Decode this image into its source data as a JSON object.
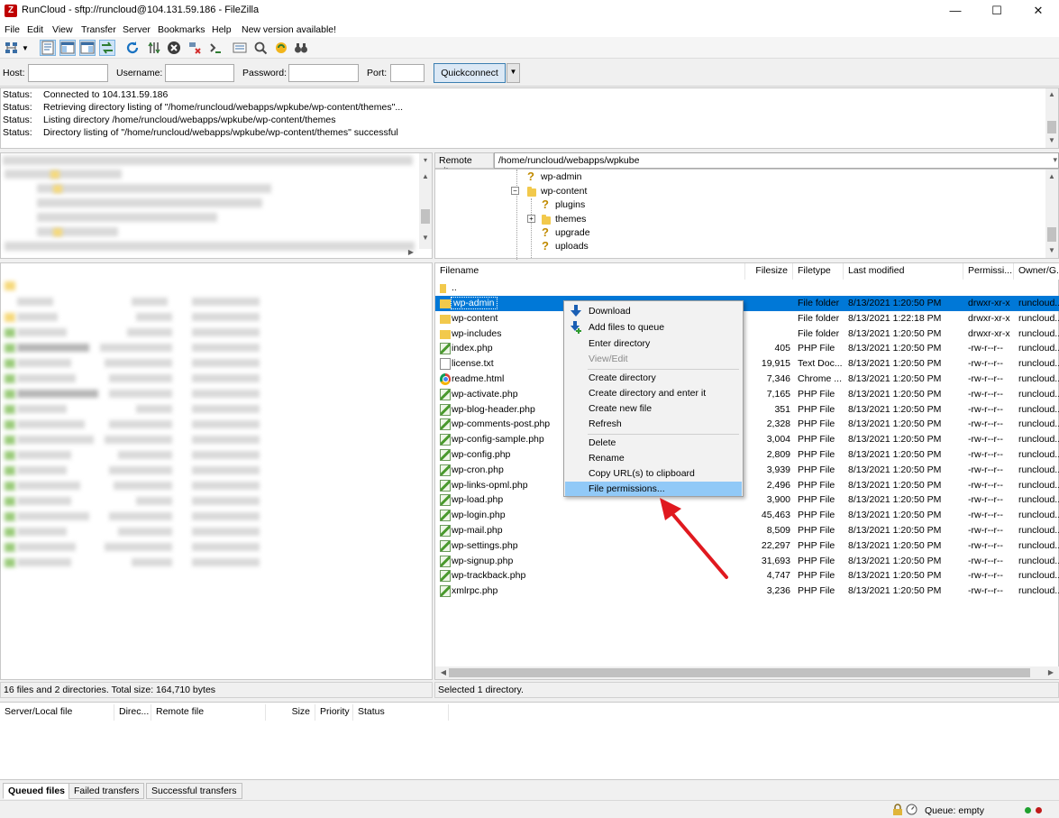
{
  "window": {
    "title": "RunCloud - sftp://runcloud@104.131.59.186 - FileZilla",
    "app_icon": "Z",
    "controls": [
      "—",
      "☐",
      "✕"
    ]
  },
  "menu": [
    "File",
    "Edit",
    "View",
    "Transfer",
    "Server",
    "Bookmarks",
    "Help",
    "New version available!"
  ],
  "quickconnect": {
    "host_label": "Host:",
    "host_value": "",
    "username_label": "Username:",
    "username_value": "",
    "password_label": "Password:",
    "password_value": "",
    "port_label": "Port:",
    "port_value": "",
    "button_label": "Quickconnect",
    "dropdown_icon": "▼"
  },
  "log": [
    {
      "k": "Status:",
      "v": "Connected to 104.131.59.186"
    },
    {
      "k": "Status:",
      "v": "Retrieving directory listing of \"/home/runcloud/webapps/wpkube/wp-content/themes\"..."
    },
    {
      "k": "Status:",
      "v": "Listing directory /home/runcloud/webapps/wpkube/wp-content/themes"
    },
    {
      "k": "Status:",
      "v": "Directory listing of \"/home/runcloud/webapps/wpkube/wp-content/themes\" successful"
    }
  ],
  "remote": {
    "site_label": "Remote site:",
    "site_path": "/home/runcloud/webapps/wpkube",
    "tree": [
      {
        "label": "wp-admin",
        "icon": "?"
      },
      {
        "label": "wp-content",
        "icon": "folder"
      },
      {
        "label": "plugins",
        "icon": "?"
      },
      {
        "label": "themes",
        "icon": "folder"
      },
      {
        "label": "upgrade",
        "icon": "?"
      },
      {
        "label": "uploads",
        "icon": "?"
      }
    ],
    "columns": [
      "Filename",
      "Filesize",
      "Filetype",
      "Last modified",
      "Permissi...",
      "Owner/G..."
    ],
    "parent_dir": "..",
    "files": [
      {
        "name": "wp-admin",
        "size": "",
        "type": "File folder",
        "modified": "8/13/2021 1:20:50 PM",
        "perms": "drwxr-xr-x",
        "owner": "runcloud...",
        "icon": "dir"
      },
      {
        "name": "wp-content",
        "size": "",
        "type": "File folder",
        "modified": "8/13/2021 1:22:18 PM",
        "perms": "drwxr-xr-x",
        "owner": "runcloud...",
        "icon": "dir"
      },
      {
        "name": "wp-includes",
        "size": "",
        "type": "File folder",
        "modified": "8/13/2021 1:20:50 PM",
        "perms": "drwxr-xr-x",
        "owner": "runcloud...",
        "icon": "dir"
      },
      {
        "name": "index.php",
        "size": "405",
        "type": "PHP File",
        "modified": "8/13/2021 1:20:50 PM",
        "perms": "-rw-r--r--",
        "owner": "runcloud...",
        "icon": "php"
      },
      {
        "name": "license.txt",
        "size": "19,915",
        "type": "Text Doc...",
        "modified": "8/13/2021 1:20:50 PM",
        "perms": "-rw-r--r--",
        "owner": "runcloud...",
        "icon": "txt"
      },
      {
        "name": "readme.html",
        "size": "7,346",
        "type": "Chrome ...",
        "modified": "8/13/2021 1:20:50 PM",
        "perms": "-rw-r--r--",
        "owner": "runcloud...",
        "icon": "chrome"
      },
      {
        "name": "wp-activate.php",
        "size": "7,165",
        "type": "PHP File",
        "modified": "8/13/2021 1:20:50 PM",
        "perms": "-rw-r--r--",
        "owner": "runcloud...",
        "icon": "php"
      },
      {
        "name": "wp-blog-header.php",
        "size": "351",
        "type": "PHP File",
        "modified": "8/13/2021 1:20:50 PM",
        "perms": "-rw-r--r--",
        "owner": "runcloud...",
        "icon": "php"
      },
      {
        "name": "wp-comments-post.php",
        "size": "2,328",
        "type": "PHP File",
        "modified": "8/13/2021 1:20:50 PM",
        "perms": "-rw-r--r--",
        "owner": "runcloud...",
        "icon": "php"
      },
      {
        "name": "wp-config-sample.php",
        "size": "3,004",
        "type": "PHP File",
        "modified": "8/13/2021 1:20:50 PM",
        "perms": "-rw-r--r--",
        "owner": "runcloud...",
        "icon": "php"
      },
      {
        "name": "wp-config.php",
        "size": "2,809",
        "type": "PHP File",
        "modified": "8/13/2021 1:20:50 PM",
        "perms": "-rw-r--r--",
        "owner": "runcloud...",
        "icon": "php"
      },
      {
        "name": "wp-cron.php",
        "size": "3,939",
        "type": "PHP File",
        "modified": "8/13/2021 1:20:50 PM",
        "perms": "-rw-r--r--",
        "owner": "runcloud...",
        "icon": "php"
      },
      {
        "name": "wp-links-opml.php",
        "size": "2,496",
        "type": "PHP File",
        "modified": "8/13/2021 1:20:50 PM",
        "perms": "-rw-r--r--",
        "owner": "runcloud...",
        "icon": "php"
      },
      {
        "name": "wp-load.php",
        "size": "3,900",
        "type": "PHP File",
        "modified": "8/13/2021 1:20:50 PM",
        "perms": "-rw-r--r--",
        "owner": "runcloud...",
        "icon": "php"
      },
      {
        "name": "wp-login.php",
        "size": "45,463",
        "type": "PHP File",
        "modified": "8/13/2021 1:20:50 PM",
        "perms": "-rw-r--r--",
        "owner": "runcloud...",
        "icon": "php"
      },
      {
        "name": "wp-mail.php",
        "size": "8,509",
        "type": "PHP File",
        "modified": "8/13/2021 1:20:50 PM",
        "perms": "-rw-r--r--",
        "owner": "runcloud...",
        "icon": "php"
      },
      {
        "name": "wp-settings.php",
        "size": "22,297",
        "type": "PHP File",
        "modified": "8/13/2021 1:20:50 PM",
        "perms": "-rw-r--r--",
        "owner": "runcloud...",
        "icon": "php"
      },
      {
        "name": "wp-signup.php",
        "size": "31,693",
        "type": "PHP File",
        "modified": "8/13/2021 1:20:50 PM",
        "perms": "-rw-r--r--",
        "owner": "runcloud...",
        "icon": "php"
      },
      {
        "name": "wp-trackback.php",
        "size": "4,747",
        "type": "PHP File",
        "modified": "8/13/2021 1:20:50 PM",
        "perms": "-rw-r--r--",
        "owner": "runcloud...",
        "icon": "php"
      },
      {
        "name": "xmlrpc.php",
        "size": "3,236",
        "type": "PHP File",
        "modified": "8/13/2021 1:20:50 PM",
        "perms": "-rw-r--r--",
        "owner": "runcloud...",
        "icon": "php"
      }
    ],
    "status": "Selected 1 directory."
  },
  "local": {
    "status": "16 files and 2 directories. Total size: 164,710 bytes"
  },
  "context_menu": [
    {
      "label": "Download",
      "icon": "download-icon",
      "disabled": false
    },
    {
      "label": "Add files to queue",
      "icon": "add-to-queue-icon",
      "disabled": false
    },
    {
      "label": "Enter directory",
      "disabled": false
    },
    {
      "label": "View/Edit",
      "disabled": true
    },
    {
      "label": "Create directory",
      "disabled": false
    },
    {
      "label": "Create directory and enter it",
      "disabled": false
    },
    {
      "label": "Create new file",
      "disabled": false
    },
    {
      "label": "Refresh",
      "disabled": false
    },
    {
      "label": "Delete",
      "disabled": false
    },
    {
      "label": "Rename",
      "disabled": false
    },
    {
      "label": "Copy URL(s) to clipboard",
      "disabled": false
    },
    {
      "label": "File permissions...",
      "disabled": false,
      "highlighted": true
    }
  ],
  "queue": {
    "columns": [
      "Server/Local file",
      "Direc...",
      "Remote file",
      "Size",
      "Priority",
      "Status"
    ],
    "tabs": [
      "Queued files",
      "Failed transfers",
      "Successful transfers"
    ],
    "status": "Queue: empty"
  },
  "colors": {
    "selection": "#0078d7",
    "context_highlight": "#91c9f7",
    "annotation_arrow": "#e0191f"
  }
}
